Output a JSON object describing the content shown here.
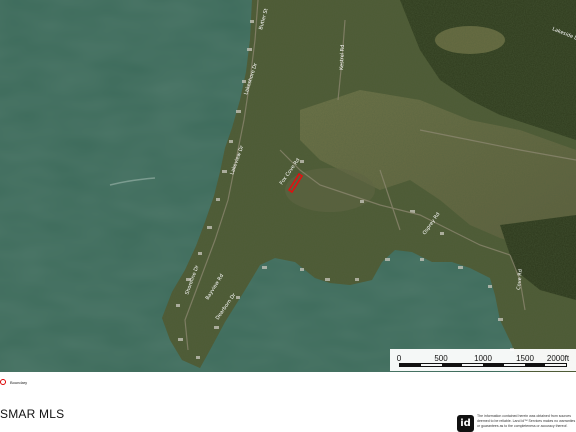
{
  "map": {
    "roads": [
      {
        "label": "Butler St"
      },
      {
        "label": "Kestrel Rd"
      },
      {
        "label": "Lakeshore Dr"
      },
      {
        "label": "Fox Cove Rd"
      },
      {
        "label": "Lakeview Dr"
      },
      {
        "label": "Shoreline Dr"
      },
      {
        "label": "Bayview Rd"
      },
      {
        "label": "Dearborn Dr"
      },
      {
        "label": "Osprey Rd"
      },
      {
        "label": "Cove Rd"
      },
      {
        "label": "Lakeside Dr"
      }
    ],
    "scale_bar": {
      "ticks": [
        "0",
        "500",
        "1000",
        "1500",
        "2000ft"
      ]
    },
    "colors": {
      "water": "#3d6b5b",
      "land": "#4e5a34",
      "boundary": "#e01010"
    }
  },
  "legend": {
    "label": "Boundary"
  },
  "footer": {
    "brand": "SMAR MLS",
    "logo_text": "id",
    "disclaimer": "The information contained herein was obtained from sources deemed to be reliable. Land id™ Services makes no warranties or guarantees as to the completeness or accuracy thereof."
  }
}
